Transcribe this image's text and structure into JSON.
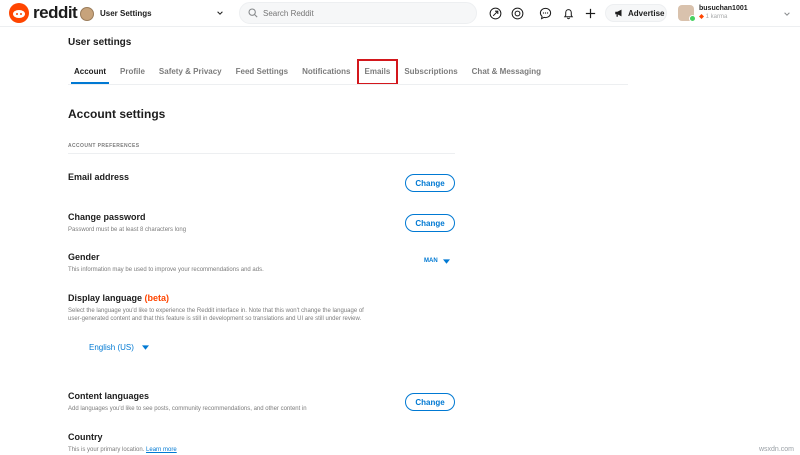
{
  "header": {
    "brand": "reddit",
    "community_label": "User Settings",
    "search_placeholder": "Search Reddit",
    "advertise_label": "Advertise",
    "user_name": "busuchan1001",
    "user_karma": "1 karma"
  },
  "page": {
    "title": "User settings"
  },
  "tabs": [
    {
      "label": "Account"
    },
    {
      "label": "Profile"
    },
    {
      "label": "Safety & Privacy"
    },
    {
      "label": "Feed Settings"
    },
    {
      "label": "Notifications"
    },
    {
      "label": "Emails"
    },
    {
      "label": "Subscriptions"
    },
    {
      "label": "Chat & Messaging"
    }
  ],
  "account": {
    "section_title": "Account settings",
    "subhead": "ACCOUNT PREFERENCES",
    "email": {
      "title": "Email address",
      "button": "Change"
    },
    "password": {
      "title": "Change password",
      "desc": "Password must be at least 8 characters long",
      "button": "Change"
    },
    "gender": {
      "title": "Gender",
      "desc": "This information may be used to improve your recommendations and ads.",
      "value": "MAN"
    },
    "language": {
      "title": "Display language",
      "beta": "(beta)",
      "desc": "Select the language you'd like to experience the Reddit interface in. Note that this won't change the language of user-generated content and that this feature is still in development so translations and UI are still under review.",
      "value": "English (US)"
    },
    "content_languages": {
      "title": "Content languages",
      "desc": "Add languages you'd like to see posts, community recommendations, and other content in",
      "button": "Change"
    },
    "country": {
      "title": "Country",
      "desc": "This is your primary location.",
      "link": "Learn more"
    }
  },
  "footer": {
    "watermark": "wsxdn.com"
  },
  "colors": {
    "accent": "#0079d3",
    "brand": "#ff4500",
    "highlight_box": "#d3171c"
  }
}
